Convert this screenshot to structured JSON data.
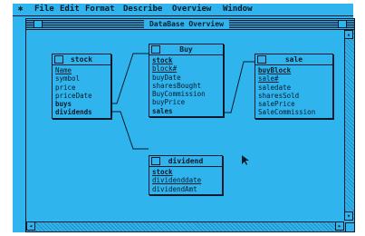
{
  "menubar": {
    "apple": "✱",
    "items": [
      "File",
      "Edit",
      "Format",
      "Describe",
      "Overview",
      "Window"
    ]
  },
  "window": {
    "title": "DataBase Overview"
  },
  "tables": {
    "stock": {
      "name": "stock",
      "fields": [
        {
          "text": "Name",
          "key": true,
          "bold": false
        },
        {
          "text": "symbol",
          "key": false,
          "bold": false
        },
        {
          "text": "price",
          "key": false,
          "bold": false
        },
        {
          "text": "priceDate",
          "key": false,
          "bold": false
        },
        {
          "text": "buys",
          "key": false,
          "bold": true
        },
        {
          "text": "dividends",
          "key": false,
          "bold": true
        }
      ]
    },
    "buy": {
      "name": "Buy",
      "fields": [
        {
          "text": "stock",
          "key": true,
          "bold": true
        },
        {
          "text": "block#",
          "key": true,
          "bold": false
        },
        {
          "text": "buyDate",
          "key": false,
          "bold": false
        },
        {
          "text": "sharesBought",
          "key": false,
          "bold": false
        },
        {
          "text": "BuyCommission",
          "key": false,
          "bold": false
        },
        {
          "text": "buyPrice",
          "key": false,
          "bold": false
        },
        {
          "text": "sales",
          "key": false,
          "bold": true
        }
      ]
    },
    "sale": {
      "name": "sale",
      "fields": [
        {
          "text": "buyBlock",
          "key": true,
          "bold": true
        },
        {
          "text": "sale#",
          "key": true,
          "bold": false
        },
        {
          "text": "saledate",
          "key": false,
          "bold": false
        },
        {
          "text": "sharesSold",
          "key": false,
          "bold": false
        },
        {
          "text": "salePrice",
          "key": false,
          "bold": false
        },
        {
          "text": "SaleCommission",
          "key": false,
          "bold": false
        }
      ]
    },
    "dividend": {
      "name": "dividend",
      "fields": [
        {
          "text": "stock",
          "key": true,
          "bold": true
        },
        {
          "text": "dividenddate",
          "key": true,
          "bold": false
        },
        {
          "text": "dividendAmt",
          "key": false,
          "bold": false
        }
      ]
    }
  },
  "colors": {
    "background": "#2fb4ee",
    "ink": "#0a1a2a"
  }
}
